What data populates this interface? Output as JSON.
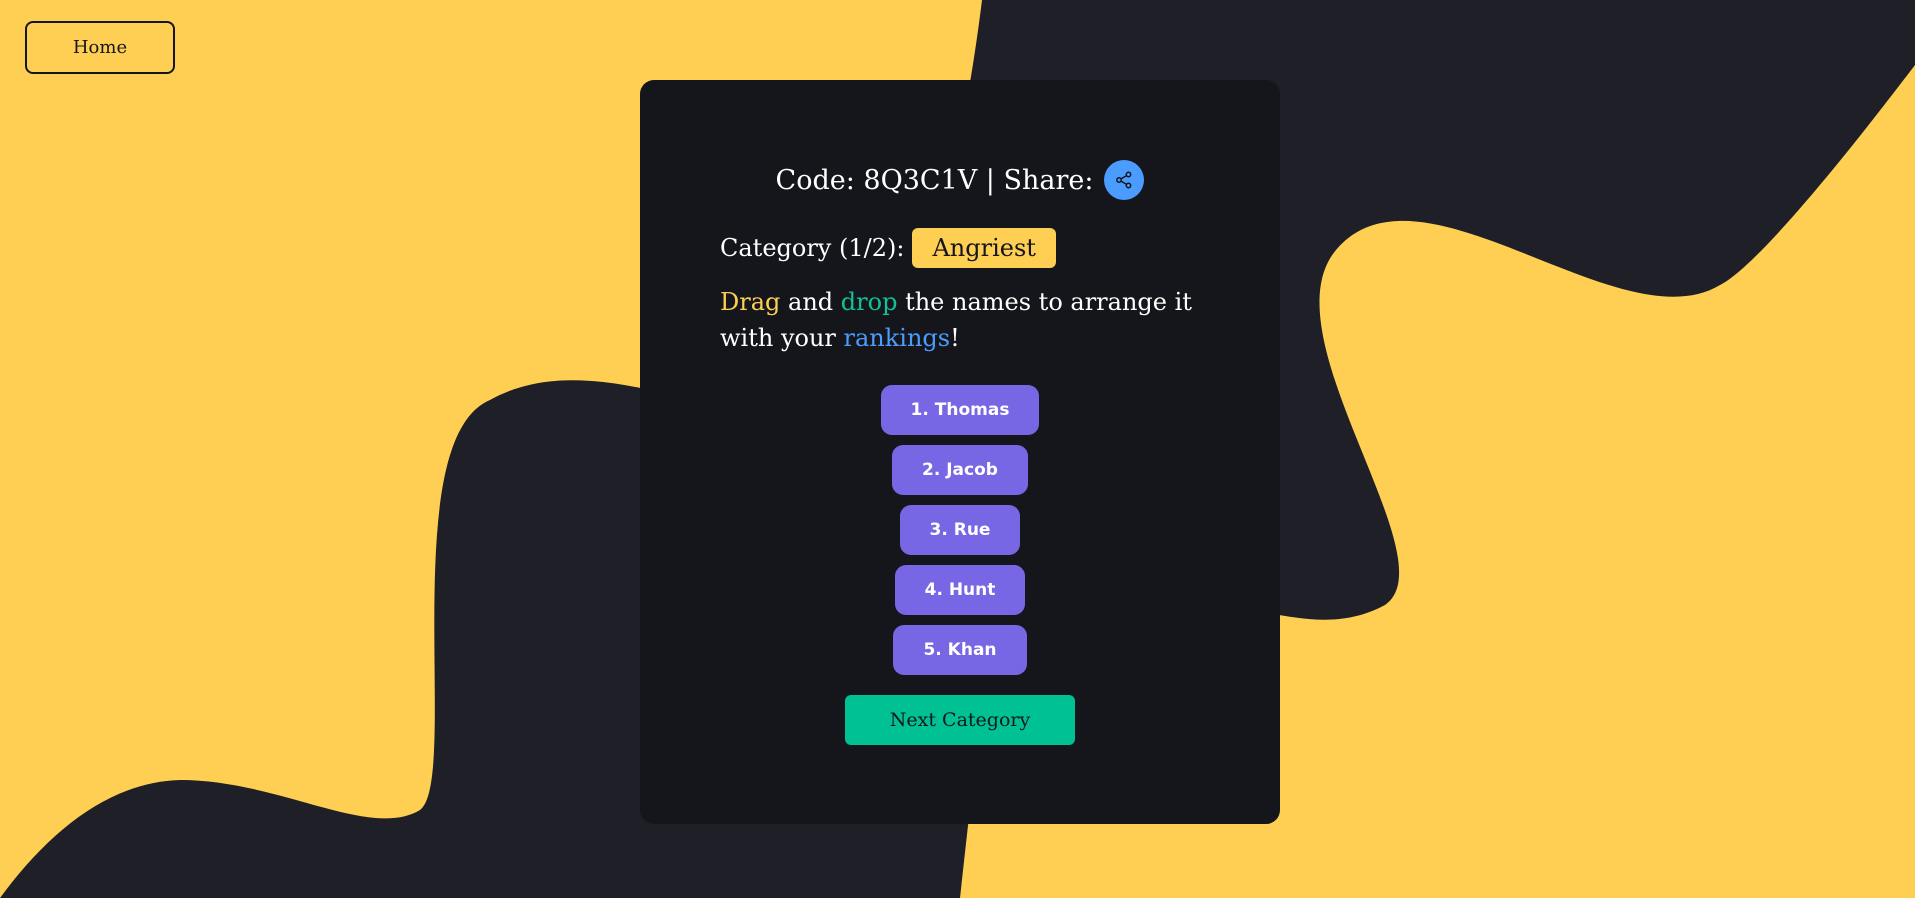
{
  "nav": {
    "home_label": "Home"
  },
  "header": {
    "code_text": "Code: 8Q3C1V | Share:",
    "share_icon": "share-icon"
  },
  "category": {
    "label": "Category (1/2):",
    "name": "Angriest"
  },
  "instructions": {
    "word_drag": "Drag",
    "text_and": " and ",
    "word_drop": "drop",
    "text_middle": " the names to arrange it with your ",
    "word_rankings": "rankings",
    "text_end": "!"
  },
  "rankings": [
    {
      "label": "1. Thomas"
    },
    {
      "label": "2. Jacob"
    },
    {
      "label": "3. Rue"
    },
    {
      "label": "4. Hunt"
    },
    {
      "label": "5. Khan"
    }
  ],
  "actions": {
    "next_label": "Next Category"
  },
  "colors": {
    "background_yellow": "#fecf52",
    "background_dark": "#1e1f27",
    "card": "#14161b",
    "share": "#4a9cff",
    "rank_item": "#7767e4",
    "next_button": "#00c193"
  }
}
